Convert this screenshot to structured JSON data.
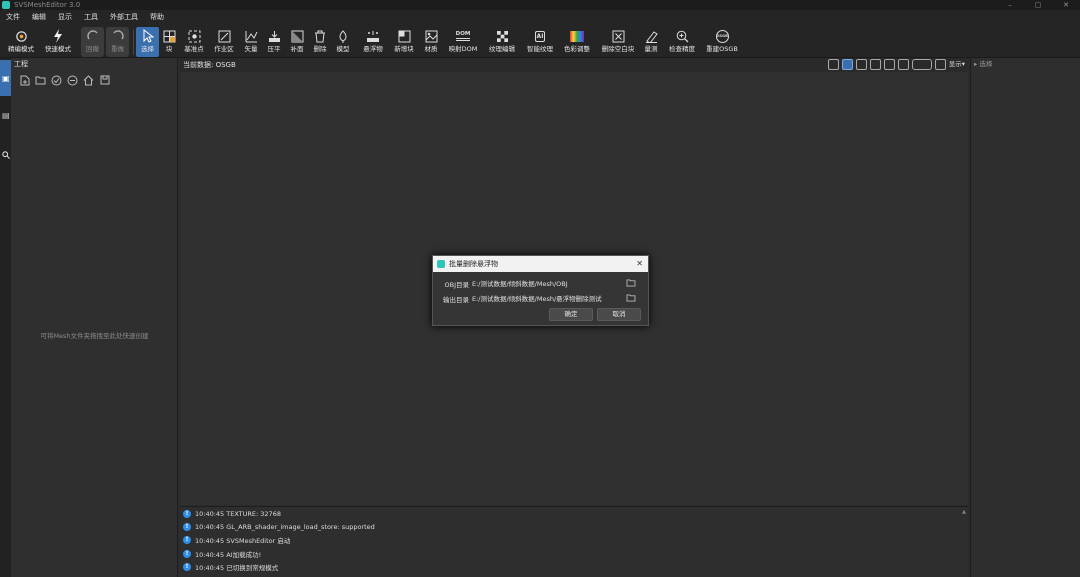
{
  "app": {
    "title": "SVSMeshEditor 3.0"
  },
  "window_controls": {
    "minimize": "–",
    "maximize": "▢",
    "close": "✕"
  },
  "menu": [
    "文件",
    "编辑",
    "显示",
    "工具",
    "外部工具",
    "帮助"
  ],
  "toolbar": {
    "items": [
      {
        "label": "精编模式",
        "icon": "precision-mode-icon"
      },
      {
        "label": "快速模式",
        "icon": "lightning-icon"
      },
      {
        "label": "回撤",
        "icon": "undo-icon"
      },
      {
        "label": "重做",
        "icon": "redo-icon"
      },
      {
        "label": "选择",
        "icon": "cursor-icon"
      },
      {
        "label": "块",
        "icon": "block-icon"
      },
      {
        "label": "基准点",
        "icon": "reference-point-icon"
      },
      {
        "label": "作业区",
        "icon": "work-area-icon"
      },
      {
        "label": "矢量",
        "icon": "vector-icon"
      },
      {
        "label": "压平",
        "icon": "flatten-icon"
      },
      {
        "label": "补面",
        "icon": "patch-face-icon"
      },
      {
        "label": "删除",
        "icon": "trash-icon"
      },
      {
        "label": "模型",
        "icon": "model-icon"
      },
      {
        "label": "悬浮物",
        "icon": "floating-object-icon"
      },
      {
        "label": "新增块",
        "icon": "add-block-icon"
      },
      {
        "label": "材质",
        "icon": "material-icon"
      },
      {
        "label": "映射DOM",
        "icon": "dom-map-icon"
      },
      {
        "label": "纹理编辑",
        "icon": "texture-edit-icon"
      },
      {
        "label": "智能纹理",
        "icon": "ai-texture-icon"
      },
      {
        "label": "色彩调整",
        "icon": "color-adjust-icon"
      },
      {
        "label": "删除空白块",
        "icon": "delete-empty-block-icon"
      },
      {
        "label": "量测",
        "icon": "measure-icon"
      },
      {
        "label": "检查精度",
        "icon": "check-precision-icon"
      },
      {
        "label": "重建OSGB",
        "icon": "rebuild-osgb-icon"
      }
    ],
    "dom_icon_text": "DOM",
    "ai_icon_text": "AI",
    "osgb_icon_text": "OSGB"
  },
  "project": {
    "header": "工程",
    "empty_text": "可将Mesh文件夹拖拽至此处快速创建"
  },
  "viewport": {
    "current_data_label": "当前数据:",
    "current_data_value": "OSGB",
    "display_label": "显示▾"
  },
  "right_panel": {
    "header": "▸ 选择"
  },
  "log": [
    "10:40:45 TEXTURE: 32768",
    "10:40:45 GL_ARB_shader_image_load_store: supported",
    "10:40:45 SVSMeshEditor 启动",
    "10:40:45 AI加载成功!",
    "10:40:45 已切换到常规模式"
  ],
  "log_icon_glyph": "!",
  "dialog": {
    "title": "批量删除悬浮物",
    "obj_label": "OBJ目录",
    "obj_value": "E:/测试数据/倾斜数据/Mesh/OBJ",
    "out_label": "输出目录",
    "out_value": "E:/测试数据/倾斜数据/Mesh/悬浮物删除测试",
    "ok": "确定",
    "cancel": "取消",
    "close": "✕"
  },
  "colors": {
    "accent": "#3a6fb0",
    "info": "#2d8fe8",
    "brand": "#2ec4b6"
  }
}
